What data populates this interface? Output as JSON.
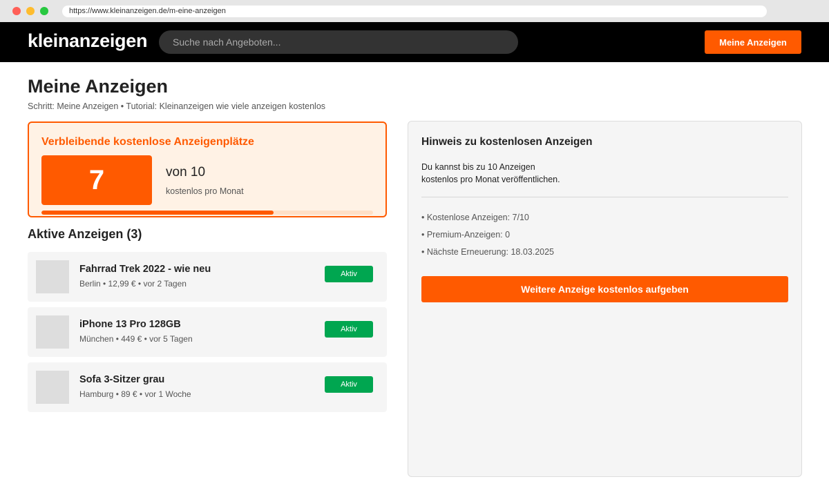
{
  "browser": {
    "url": "https://www.kleinanzeigen.de/m-eine-anzeigen"
  },
  "header": {
    "logo": "kleinanzeigen",
    "search_placeholder": "Suche nach Angeboten...",
    "nav_button": "Meine Anzeigen"
  },
  "page": {
    "title": "Meine Anzeigen",
    "breadcrumb": "Schritt: Meine Anzeigen • Tutorial: Kleinanzeigen wie viele anzeigen kostenlos"
  },
  "quota": {
    "title": "Verbleibende kostenlose Anzeigenplätze",
    "remaining": "7",
    "of_total": "von 10",
    "subtitle": "kostenlos pro Monat",
    "progress_fraction": 0.7
  },
  "active": {
    "heading": "Aktive Anzeigen (3)",
    "items": [
      {
        "title": "Fahrrad Trek 2022 - wie neu",
        "meta": "Berlin • 12,99 € • vor 2 Tagen",
        "status": "Aktiv"
      },
      {
        "title": "iPhone 13 Pro 128GB",
        "meta": "München • 449 € • vor 5 Tagen",
        "status": "Aktiv"
      },
      {
        "title": "Sofa 3-Sitzer grau",
        "meta": "Hamburg • 89 € • vor 1 Woche",
        "status": "Aktiv"
      }
    ]
  },
  "hint": {
    "title": "Hinweis zu kostenlosen Anzeigen",
    "text_line1": "Du kannst bis zu 10 Anzeigen",
    "text_line2": "kostenlos pro Monat veröffentlichen.",
    "facts": [
      "• Kostenlose Anzeigen: 7/10",
      "• Premium-Anzeigen: 0",
      "• Nächste Erneuerung: 18.03.2025"
    ],
    "cta": "Weitere Anzeige kostenlos aufgeben"
  },
  "colors": {
    "brand_orange": "#ff5a00",
    "status_green": "#00a650",
    "header_black": "#000000"
  }
}
